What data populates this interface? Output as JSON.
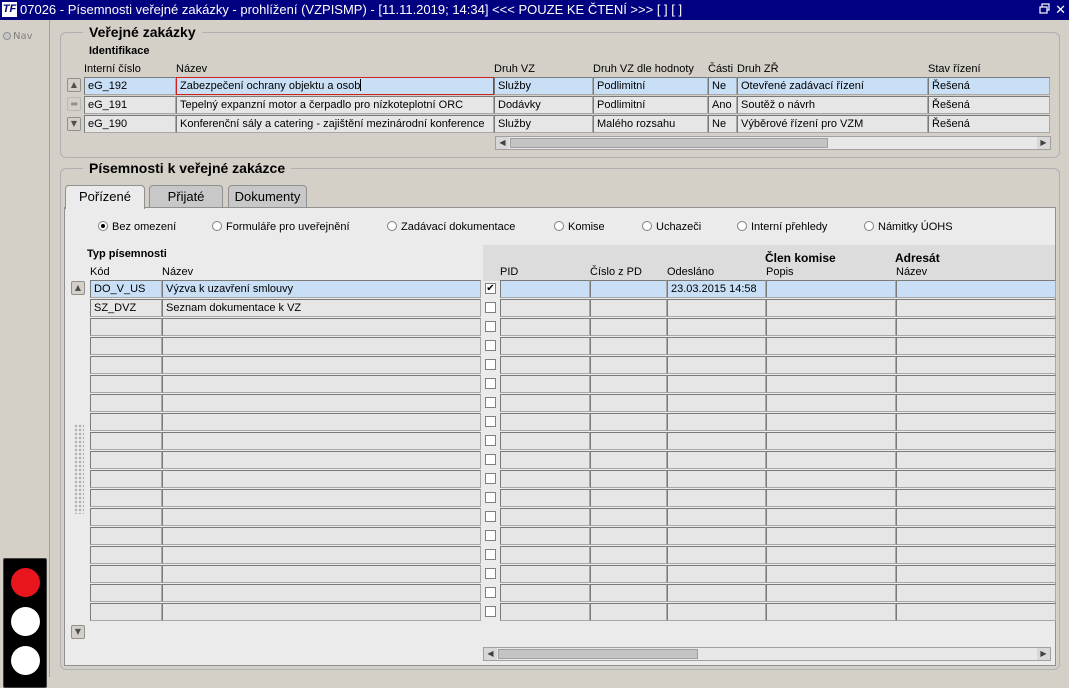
{
  "window": {
    "title": "07026 - Písemnosti veřejné zakázky - prohlížení (VZPISMP) - [11.11.2019; 14:34] <<< POUZE KE ČTENÍ >>>  [ ]  [ ]",
    "app_icon_text": "TF"
  },
  "left_rail": {
    "nav_label": "Nav"
  },
  "zakazky": {
    "title": "Veřejné zakázky",
    "subtitle": "Identifikace",
    "headers": [
      "Interní číslo",
      "Název",
      "Druh VZ",
      "Druh VZ dle hodnoty",
      "Části",
      "Druh ZŘ",
      "Stav řízení"
    ],
    "rows": [
      [
        "eG_192",
        "Zabezpečení ochrany objektu a osob",
        "Služby",
        "Podlimitní",
        "Ne",
        "Otevřené zadávací řízení",
        "Řešená"
      ],
      [
        "eG_191",
        "Tepelný expanzní motor a čerpadlo pro nízkoteplotní ORC",
        "Dodávky",
        "Podlimitní",
        "Ano",
        "Soutěž o návrh",
        "Řešená"
      ],
      [
        "eG_190",
        "Konferenční sály a catering - zajištění mezinárodní konference",
        "Služby",
        "Malého rozsahu",
        "Ne",
        "Výběrové řízení pro VZM",
        "Řešená"
      ]
    ]
  },
  "pisemnosti": {
    "title": "Písemnosti k veřejné zakázce",
    "tabs": [
      "Pořízené",
      "Přijaté",
      "Dokumenty"
    ],
    "filters": [
      "Bez omezení",
      "Formuláře pro uveřejnění",
      "Zadávací dokumentace",
      "Komise",
      "Uchazeči",
      "Interní přehledy",
      "Námitky ÚOHS"
    ],
    "selected_filter": "Bez omezení",
    "typ_label": "Typ písemnosti",
    "clen_label": "Člen komise",
    "adresat_label": "Adresát",
    "headers": {
      "kod": "Kód",
      "nazev": "Název",
      "pid": "PID",
      "cislo": "Číslo z PD",
      "odeslano": "Odesláno",
      "popis": "Popis",
      "adr_nazev": "Název"
    },
    "rows": [
      {
        "kod": "DO_V_US",
        "nazev": "Výzva k uzavření smlouvy",
        "checked": true,
        "pid": "",
        "cislo": "",
        "odeslano": "23.03.2015 14:58",
        "popis": "",
        "adr_nazev": ""
      },
      {
        "kod": "SZ_DVZ",
        "nazev": "Seznam dokumentace k VZ",
        "checked": false,
        "pid": "",
        "cislo": "",
        "odeslano": "",
        "popis": "",
        "adr_nazev": ""
      }
    ],
    "empty_rows": 16
  }
}
